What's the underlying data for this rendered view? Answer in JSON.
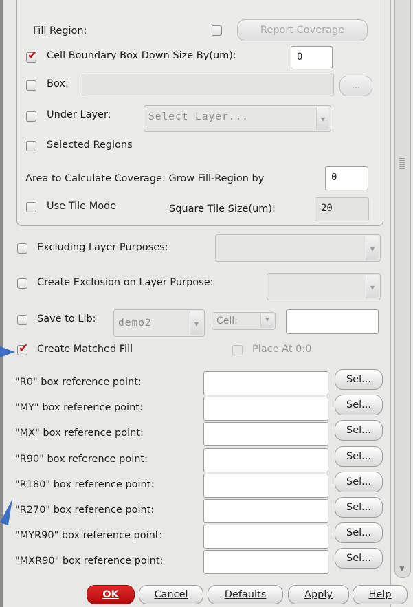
{
  "fill_region": {
    "label": "Fill Region:",
    "report_coverage_label": "Report Coverage",
    "cell_boundary_label": "Cell Boundary Box Down Size By(um):",
    "cell_boundary_value": "0",
    "box_label": "Box:",
    "box_value": "",
    "box_browse_label": "...",
    "under_layer_label": "Under Layer:",
    "under_layer_select": "Select Layer...",
    "selected_regions_label": "Selected Regions",
    "area_coverage_label": "Area to Calculate Coverage: Grow Fill-Region by",
    "area_coverage_value": "0",
    "tile_mode_label": "Use Tile Mode",
    "tile_size_label": "Square Tile Size(um):",
    "tile_size_value": "20"
  },
  "options": {
    "excluding_label": "Excluding Layer Purposes:",
    "exclusion_label": "Create Exclusion on Layer Purpose:",
    "save_lib_label": "Save to Lib:",
    "lib_value": "demo2",
    "cell_label": "Cell:",
    "cell_value": "",
    "matched_fill_label": "Create Matched Fill",
    "place_label": "Place At 0:0"
  },
  "ref_points": [
    {
      "label": "\"R0\" box reference point:",
      "value": "",
      "sel": "Sel..."
    },
    {
      "label": "\"MY\" box reference point:",
      "value": "",
      "sel": "Sel..."
    },
    {
      "label": "\"MX\" box reference point:",
      "value": "",
      "sel": "Sel..."
    },
    {
      "label": "\"R90\" box reference point:",
      "value": "",
      "sel": "Sel..."
    },
    {
      "label": "\"R180\" box reference point:",
      "value": "",
      "sel": "Sel..."
    },
    {
      "label": "\"R270\" box reference point:",
      "value": "",
      "sel": "Sel..."
    },
    {
      "label": "\"MYR90\" box reference point:",
      "value": "",
      "sel": "Sel..."
    },
    {
      "label": "\"MXR90\" box reference point:",
      "value": "",
      "sel": "Sel..."
    }
  ],
  "footer": {
    "ok": "OK",
    "cancel": "Cancel",
    "defaults": "Defaults",
    "apply": "Apply",
    "help": "Help"
  },
  "checks": {
    "report_coverage": false,
    "cell_boundary": true,
    "box": false,
    "under_layer": false,
    "selected_regions": false,
    "tile_mode": false,
    "excluding": false,
    "exclusion": false,
    "save_lib": false,
    "matched_fill": true,
    "place": false
  },
  "colors": {
    "accent_red": "#c4121a",
    "annotation_arrow": "#3f6fc4"
  }
}
